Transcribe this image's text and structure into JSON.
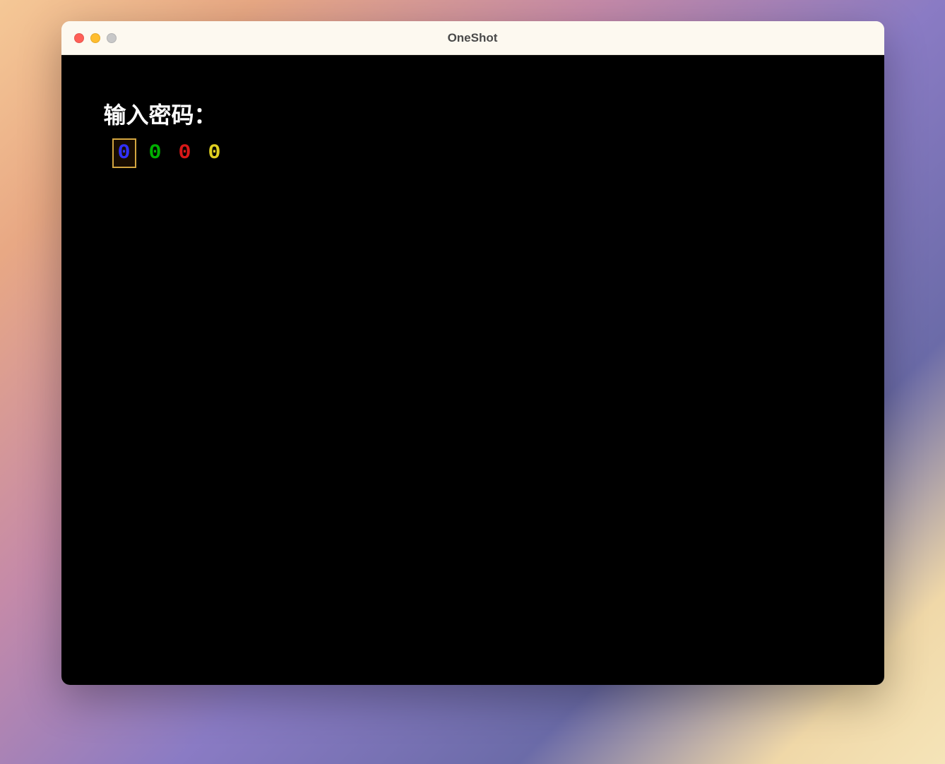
{
  "window": {
    "title": "OneShot"
  },
  "game": {
    "prompt": "输入密码：",
    "digits": [
      {
        "value": "0",
        "color": "blue",
        "selected": true
      },
      {
        "value": "0",
        "color": "green",
        "selected": false
      },
      {
        "value": "0",
        "color": "red",
        "selected": false
      },
      {
        "value": "0",
        "color": "yellow",
        "selected": false
      }
    ]
  }
}
